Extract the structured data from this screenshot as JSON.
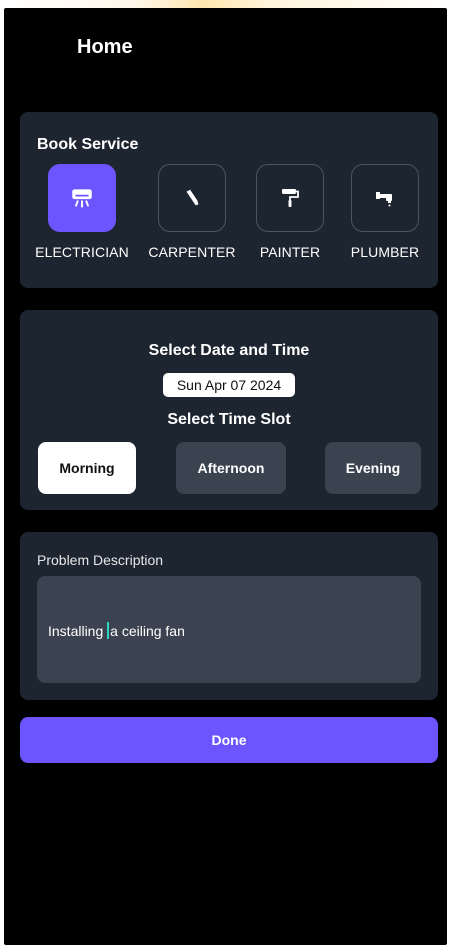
{
  "header": {
    "title": "Home"
  },
  "book_service": {
    "heading": "Book Service",
    "services": [
      {
        "label": "ELECTRICIAN",
        "icon": "air-conditioner-icon",
        "selected": true
      },
      {
        "label": "CARPENTER",
        "icon": "chisel-icon",
        "selected": false
      },
      {
        "label": "PAINTER",
        "icon": "paint-roller-icon",
        "selected": false
      },
      {
        "label": "PLUMBER",
        "icon": "pipe-icon",
        "selected": false
      }
    ]
  },
  "date_time": {
    "heading": "Select Date and Time",
    "date": "Sun Apr 07 2024",
    "slot_heading": "Select Time Slot",
    "slots": [
      {
        "label": "Morning",
        "selected": true
      },
      {
        "label": "Afternoon",
        "selected": false
      },
      {
        "label": "Evening",
        "selected": false
      }
    ]
  },
  "problem": {
    "label": "Problem Description",
    "value_before_cursor": "Installing ",
    "value_after_cursor": "a ceiling fan"
  },
  "done_label": "Done",
  "colors": {
    "accent": "#6c55ff",
    "card": "#1d2530",
    "input": "#3b4350",
    "cursor": "#2dd4bf"
  }
}
